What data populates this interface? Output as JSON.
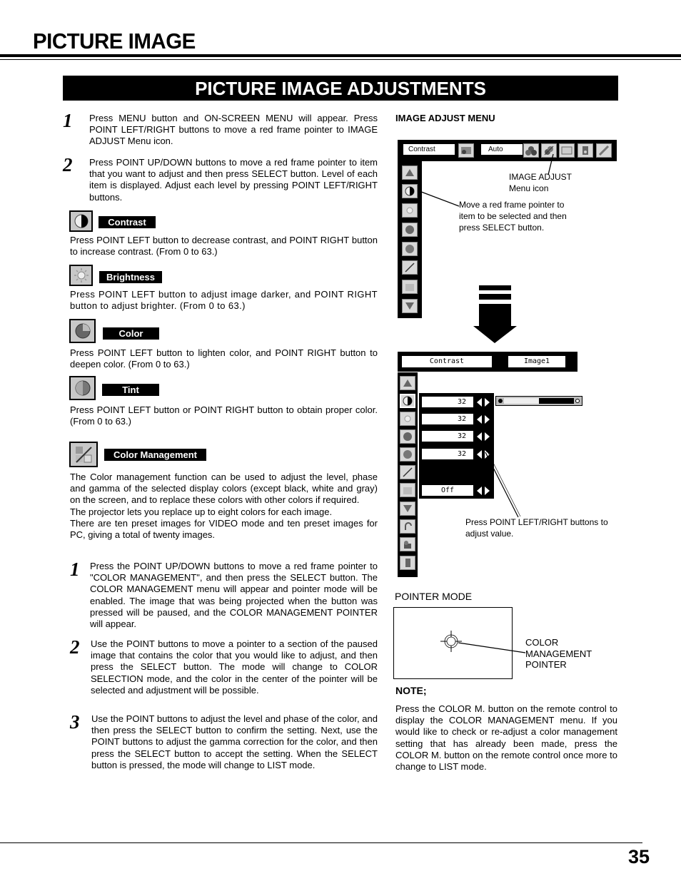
{
  "header": {
    "title": "PICTURE IMAGE",
    "section_title": "PICTURE IMAGE ADJUSTMENTS"
  },
  "steps_intro": [
    {
      "num": "1",
      "text": "Press MENU button and ON-SCREEN MENU will appear.  Press POINT LEFT/RIGHT buttons to move a red frame pointer to IMAGE ADJUST Menu icon."
    },
    {
      "num": "2",
      "text": "Press POINT UP/DOWN buttons to move a red frame pointer to item that you want to adjust and then press SELECT button. Level of each item is displayed.  Adjust each level by pressing POINT LEFT/RIGHT buttons."
    }
  ],
  "items": [
    {
      "label": "Contrast",
      "icon": "contrast-icon",
      "text": "Press POINT LEFT button to decrease contrast, and POINT RIGHT button to increase contrast.  (From 0 to 63.)"
    },
    {
      "label": "Brightness",
      "icon": "brightness-icon",
      "text": "Press POINT LEFT button to adjust image darker, and POINT RIGHT button to adjust brighter.  (From 0 to 63.)"
    },
    {
      "label": "Color",
      "icon": "color-icon",
      "text": "Press POINT LEFT button to lighten color, and POINT RIGHT button to deepen color.  (From 0 to 63.)"
    },
    {
      "label": "Tint",
      "icon": "tint-icon",
      "text": "Press POINT LEFT button or POINT RIGHT button to obtain proper color.  (From 0 to 63.)"
    },
    {
      "label": "Color Management",
      "icon": "color-management-icon",
      "text": "The Color management function can be used to adjust the level, phase and gamma of the selected display colors (except black, white and gray) on the screen, and to replace these colors with other colors if required.\nThe projector lets you replace up to eight colors for each image.\nThere are ten preset images for VIDEO mode and ten preset images for PC, giving a total of twenty images."
    }
  ],
  "steps_cm": [
    {
      "num": "1",
      "text": "Press the POINT UP/DOWN buttons to move a red frame pointer to \"COLOR MANAGEMENT\", and then press the SELECT button. The COLOR MANAGEMENT menu will appear and pointer mode will be enabled. The image that was being projected when the button was pressed will be paused, and the COLOR MANAGEMENT POINTER will appear."
    },
    {
      "num": "2",
      "text": "Use the POINT buttons to move a pointer to a section of the paused image that contains the color that you would like to adjust, and then press the SELECT button. The mode will change to COLOR SELECTION mode, and the color in the center of the pointer will be selected and adjustment will be possible."
    },
    {
      "num": "3",
      "text": "Use the POINT buttons to adjust the level and phase of the color, and then press the SELECT button to confirm the setting. Next, use the POINT buttons to adjust the gamma correction for the color, and then press the SELECT button to accept the setting. When the SELECT button is pressed, the mode will change to LIST mode."
    }
  ],
  "image_adjust_menu": {
    "title": "IMAGE ADJUST MENU",
    "top_bar": {
      "field1": "Contrast",
      "field2": "Auto"
    },
    "callout_icon": "IMAGE ADJUST\nMenu icon",
    "callout_pointer": "Move a red frame pointer to item to be selected and then press SELECT button."
  },
  "adjust_menu": {
    "header_left": "Contrast",
    "header_right": "Image1",
    "values": [
      "32",
      "32",
      "32",
      "32",
      "Off"
    ],
    "slider_level": 0.5,
    "callout": "Press POINT LEFT/RIGHT buttons to adjust value."
  },
  "pointer_mode": {
    "title": "POINTER MODE",
    "callout": "COLOR\nMANAGEMENT\nPOINTER"
  },
  "note": {
    "title": "NOTE;",
    "text": "Press the COLOR M. button on the remote control to display the COLOR MANAGEMENT menu. If you would like to check or re-adjust a color management setting that has already been made, press the COLOR M. button on the remote control once more to change to LIST mode."
  },
  "footer": {
    "page_number": "35"
  }
}
